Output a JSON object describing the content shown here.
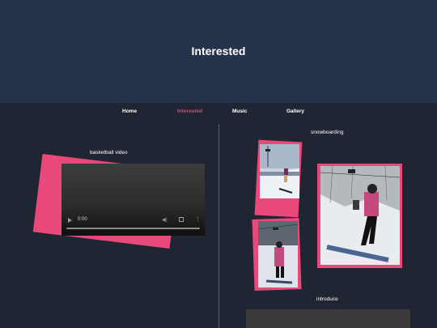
{
  "header": {
    "title": "Interested"
  },
  "nav": {
    "items": [
      {
        "label": "Home"
      },
      {
        "label": "Interested"
      },
      {
        "label": "Music"
      },
      {
        "label": "Gallery"
      }
    ]
  },
  "basketball": {
    "label": "basketball video",
    "video": {
      "time": "0:00",
      "progress": 0
    }
  },
  "snowboarding": {
    "label": "snowboarding"
  },
  "introduce": {
    "label": "introduce"
  },
  "colors": {
    "header_bg": "#243349",
    "page_bg": "#1f2532",
    "accent": "#e8407a"
  },
  "icons": [
    "play-icon",
    "volume-icon",
    "fullscreen-icon",
    "more-icon"
  ]
}
